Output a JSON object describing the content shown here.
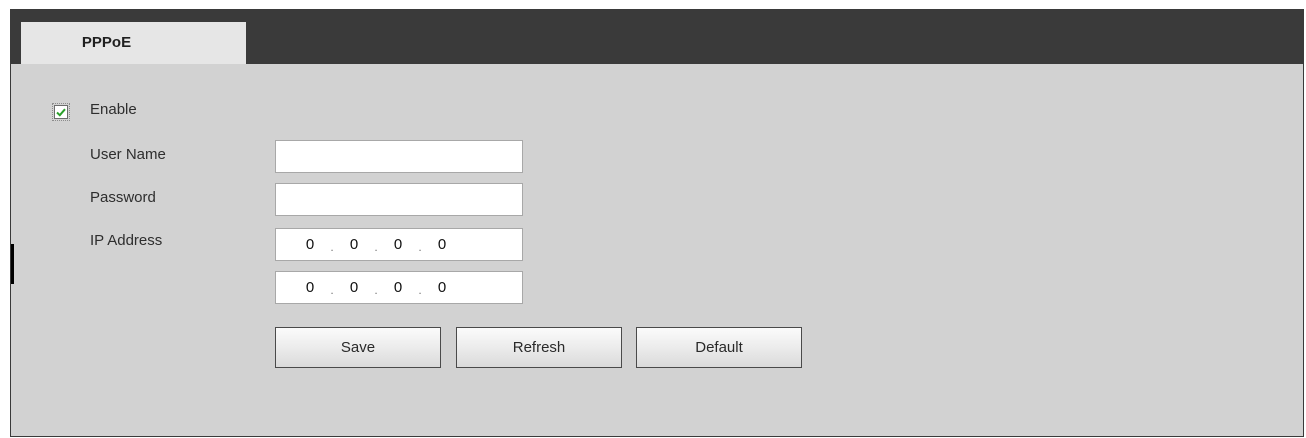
{
  "tabs": [
    {
      "label": "PPPoE",
      "active": true
    }
  ],
  "form": {
    "enable": {
      "label": "Enable",
      "checked": true
    },
    "user_name": {
      "label": "User Name",
      "value": ""
    },
    "password": {
      "label": "Password",
      "value": ""
    },
    "ip_address": {
      "label": "IP Address",
      "primary": [
        "0",
        "0",
        "0",
        "0"
      ],
      "secondary": [
        "0",
        "0",
        "0",
        "0"
      ],
      "separator": "."
    }
  },
  "buttons": {
    "save": "Save",
    "refresh": "Refresh",
    "default": "Default"
  },
  "colors": {
    "panel_bg": "#d2d2d2",
    "tab_strip_bg": "#3a3a3a",
    "tab_active_bg": "#e6e6e6",
    "checkmark": "#2aa02a"
  }
}
